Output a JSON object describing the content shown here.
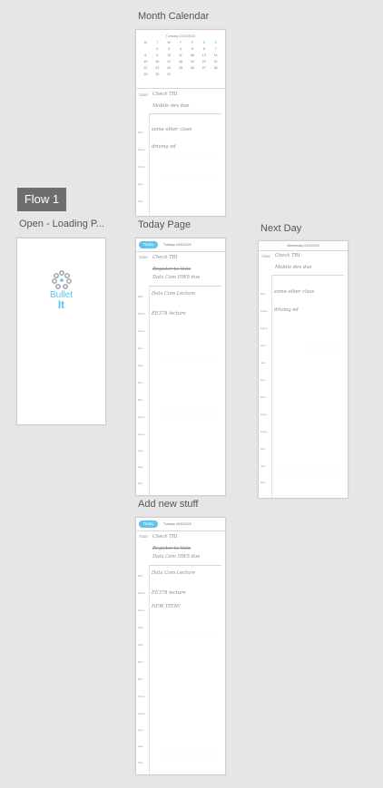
{
  "flow": {
    "badge": "Flow 1"
  },
  "screens": {
    "loading": {
      "label": "Open - Loading P...",
      "logo_word1": "Bullet",
      "logo_word2": "It"
    },
    "month_calendar": {
      "label": "Month Calendar",
      "date_header": "Tuesday 03/10/2020",
      "weekdays": [
        "M",
        "T",
        "W",
        "T",
        "F",
        "S",
        "S"
      ],
      "days": [
        "2",
        "3",
        "4",
        "5",
        "6",
        "7",
        "8",
        "9",
        "10",
        "11",
        "12",
        "13",
        "14",
        "15",
        "16",
        "17",
        "18",
        "19",
        "20",
        "21",
        "22",
        "23",
        "24",
        "25",
        "26",
        "27",
        "28",
        "29",
        "30",
        "31"
      ],
      "todo_tag": "TODO",
      "todos": [
        "Check TRI",
        "Mobile dev due"
      ],
      "events": [
        "some other class",
        "driving ed"
      ],
      "times": [
        "8am",
        "10am",
        "12pm",
        "2pm",
        "4pm"
      ]
    },
    "today_page": {
      "label": "Today Page",
      "today_button": "Today",
      "date_header": "Tuesday 03/10/2020",
      "todo_tag": "TODO",
      "todos": [
        "Check TRI",
        "Register to Vote",
        "Data Com HW5 due"
      ],
      "events": [
        "Data Com Lecture",
        "EE378 lecture"
      ],
      "times": [
        "8am",
        "10am",
        "12pm",
        "2pm",
        "4pm",
        "6pm",
        "8pm",
        "10pm",
        "12am",
        "2am",
        "4am",
        "6am",
        "8am",
        "10am",
        "12pm"
      ]
    },
    "next_day": {
      "label": "Next Day",
      "date_header": "Wednesday 03/11/2020",
      "todo_tag": "TODO",
      "todos": [
        "Check TRI",
        "Mobile dev due"
      ],
      "events": [
        "some other class",
        "driving ed"
      ],
      "times": [
        "8am",
        "10am",
        "12pm",
        "2pm",
        "4pm",
        "6pm",
        "8pm",
        "10pm",
        "12am",
        "2am",
        "4am",
        "6am"
      ]
    },
    "add_new": {
      "label": "Add new stuff",
      "today_button": "Today",
      "date_header": "Tuesday 03/10/2020",
      "todo_tag": "TODO",
      "todos": [
        "Check TRI",
        "Register to Vote",
        "Data Com HW5 due"
      ],
      "events": [
        "Data Com Lecture",
        "EE378 lecture",
        "NEW ITEM!"
      ],
      "times": [
        "8am",
        "10am",
        "12pm",
        "2pm",
        "4pm",
        "6pm",
        "8pm",
        "10pm",
        "12am",
        "2am",
        "4am",
        "6am",
        "8am",
        "10am",
        "12pm"
      ]
    }
  }
}
